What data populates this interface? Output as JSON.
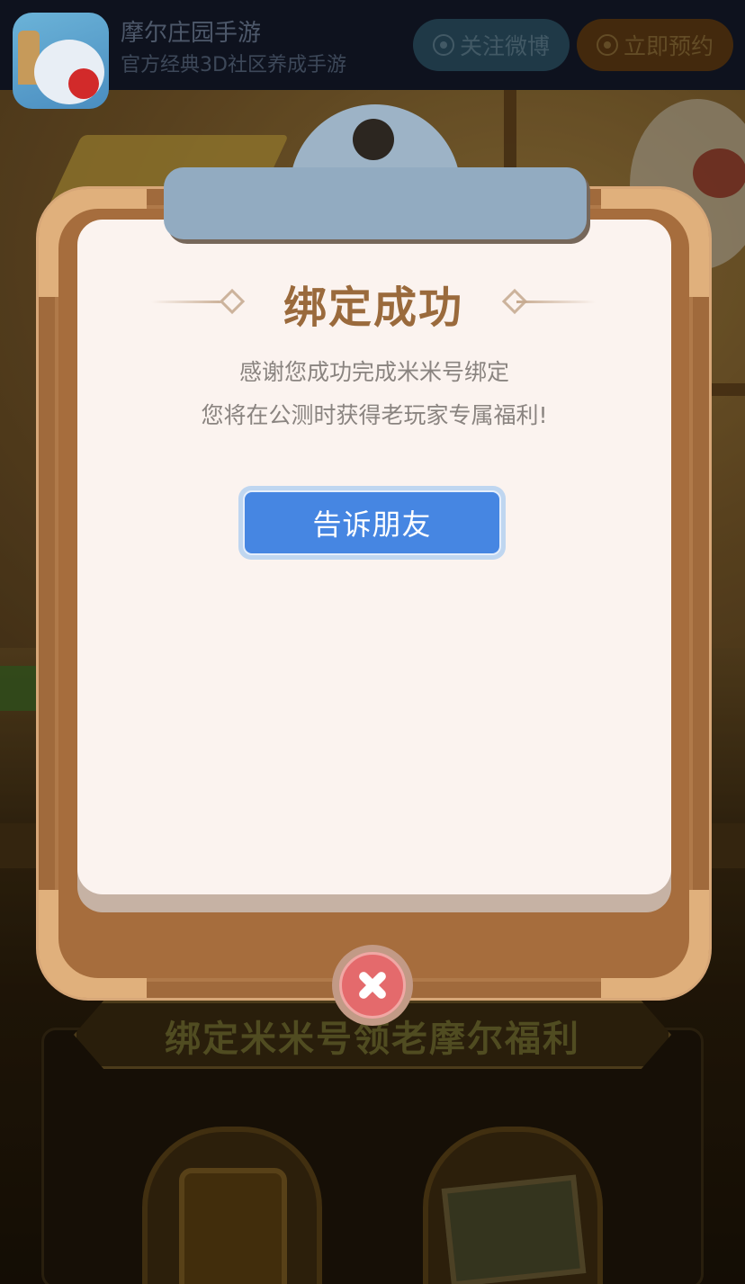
{
  "app_bar": {
    "title": "摩尔庄园手游",
    "subtitle": "官方经典3D社区养成手游",
    "follow_label": "关注微博",
    "reserve_label": "立即预约",
    "icon": "app-icon-mole-manor"
  },
  "background": {
    "banner_text": "绑定米米号领老摩尔福利"
  },
  "modal": {
    "title": "绑定成功",
    "message_line1": "感谢您成功完成米米号绑定",
    "message_line2": "您将在公测时获得老玩家专属福利!",
    "share_label": "告诉朋友",
    "close_icon": "close-icon"
  },
  "colors": {
    "share_button": "#4686e2",
    "close_button": "#e46a6c",
    "title": "#9a6a3c",
    "board": "#b07a4a"
  }
}
